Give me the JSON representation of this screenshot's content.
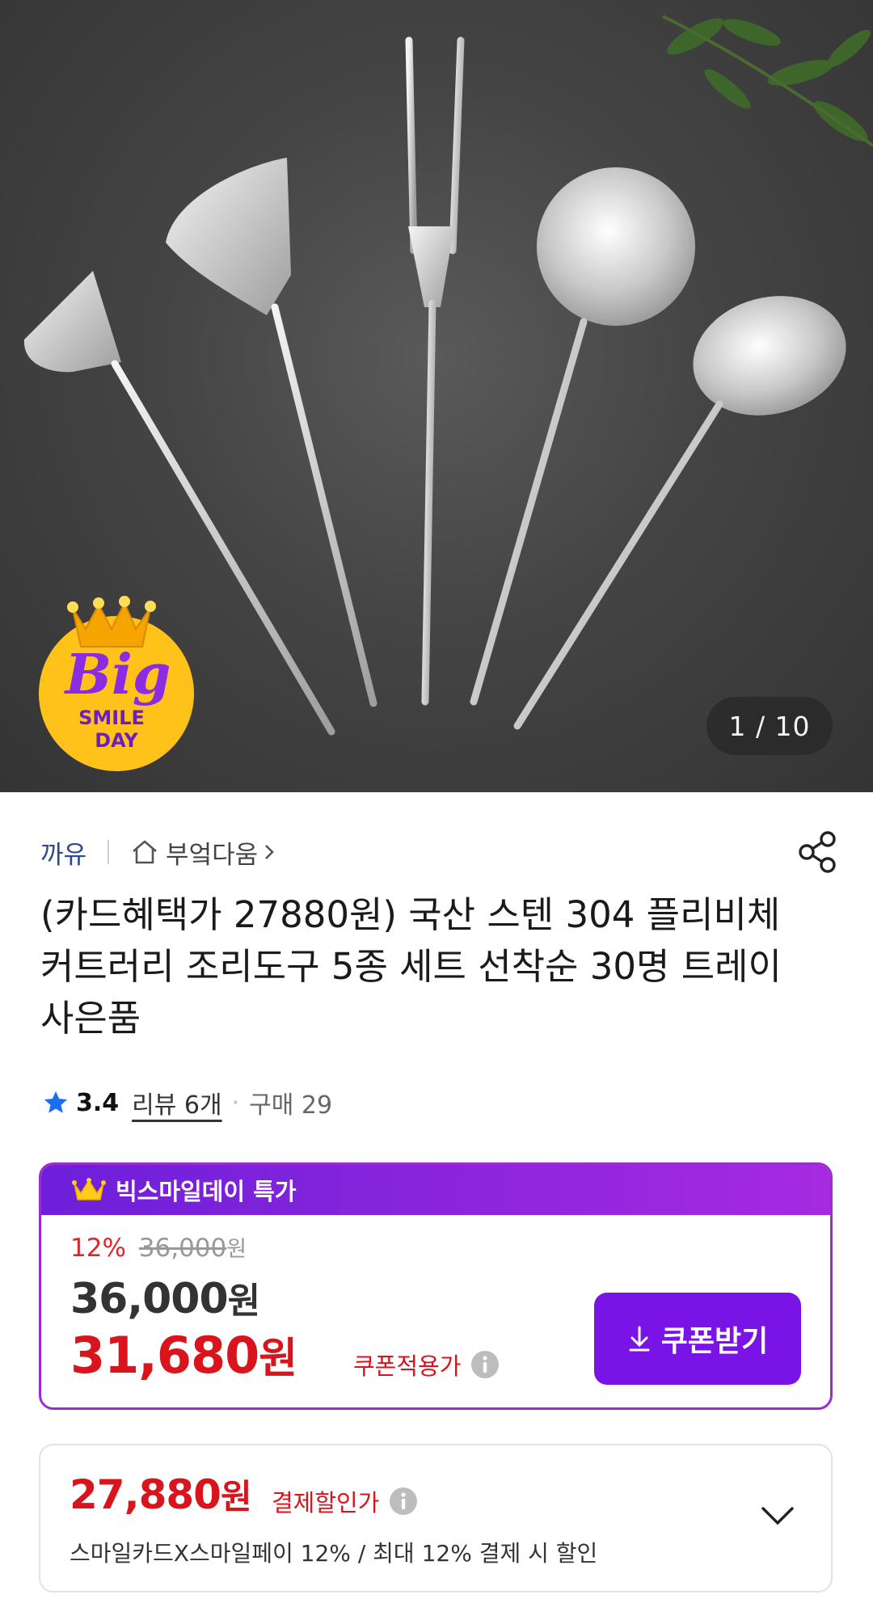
{
  "gallery": {
    "counter": "1 / 10",
    "badge": {
      "big": "Big",
      "smile": "SMILE",
      "day": "DAY"
    }
  },
  "seller": {
    "brand": "까유",
    "store": "부엌다움"
  },
  "product": {
    "title": "(카드혜택가 27880원) 국산 스텐 304 플리비체 커트러리 조리도구 5종 세트 선착순 30명 트레이 사은품",
    "rating": "3.4",
    "review_label": "리뷰 6개",
    "dot": "·",
    "purchase_label": "구매 29"
  },
  "promo": {
    "header": "빅스마일데이 특가",
    "discount_pct": "12%",
    "original_price": "36,000",
    "original_unit": "원",
    "base_price": "36,000",
    "base_unit": "원",
    "coupon_price": "31,680",
    "coupon_unit": "원",
    "coupon_label": "쿠폰적용가",
    "coupon_button": "쿠폰받기"
  },
  "payment": {
    "price": "27,880",
    "unit": "원",
    "label": "결제할인가",
    "description": "스마일카드X스마일페이 12% / 최대 12% 결제 시 할인"
  },
  "colors": {
    "accent_purple": "#7a14e6",
    "price_red": "#d8141d",
    "brand_blue": "#2a4a8c"
  }
}
